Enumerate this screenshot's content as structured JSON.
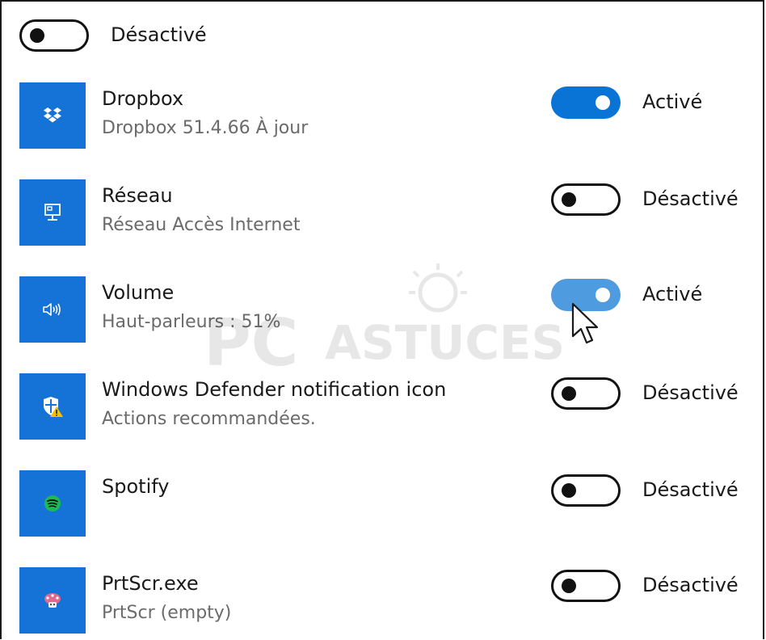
{
  "top_toggle": {
    "state": "off",
    "label": "Désactivé"
  },
  "apps": [
    {
      "name": "Dropbox",
      "subtitle": "Dropbox 51.4.66 À jour",
      "icon": "dropbox-icon",
      "toggle_state": "on",
      "toggle_label": "Activé"
    },
    {
      "name": "Réseau",
      "subtitle": "Réseau Accès Internet",
      "icon": "network-icon",
      "toggle_state": "off",
      "toggle_label": "Désactivé"
    },
    {
      "name": "Volume",
      "subtitle": "Haut-parleurs : 51%",
      "icon": "speaker-icon",
      "toggle_state": "on",
      "toggle_label": "Activé"
    },
    {
      "name": "Windows Defender notification icon",
      "subtitle": "Actions recommandées.",
      "icon": "defender-shield-warning-icon",
      "toggle_state": "off",
      "toggle_label": "Désactivé"
    },
    {
      "name": "Spotify",
      "subtitle": "",
      "icon": "spotify-icon",
      "toggle_state": "off",
      "toggle_label": "Désactivé"
    },
    {
      "name": "PrtScr.exe",
      "subtitle": "PrtScr (empty)",
      "icon": "prtscr-icon",
      "toggle_state": "off",
      "toggle_label": "Désactivé"
    }
  ],
  "watermark": {
    "text_a": "PC",
    "text_b": "ASTUCES"
  },
  "colors": {
    "accent": "#0a74d6",
    "tile": "#1572d6",
    "spotify": "#1db954",
    "warning": "#f2c200"
  }
}
